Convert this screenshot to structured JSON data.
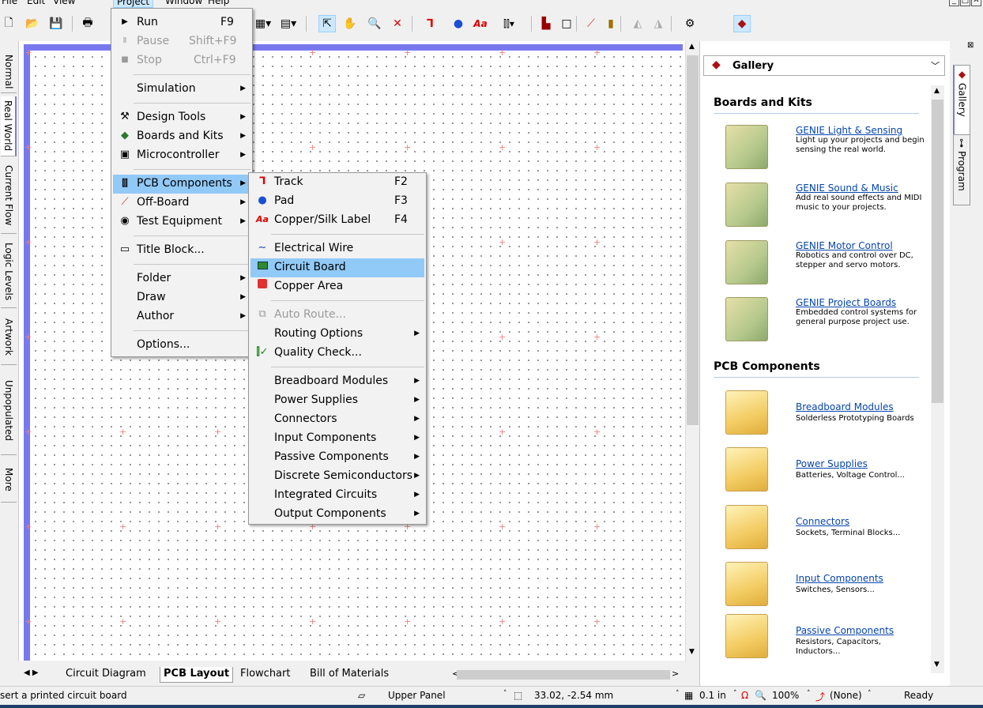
{
  "menubar": {
    "items": [
      "File",
      "Edit",
      "View",
      "Project",
      "Window",
      "Help"
    ],
    "active": "Project"
  },
  "project_menu": {
    "run": {
      "label": "Run",
      "shortcut": "F9"
    },
    "pause": {
      "label": "Pause",
      "shortcut": "Shift+F9"
    },
    "stop": {
      "label": "Stop",
      "shortcut": "Ctrl+F9"
    },
    "simulation": "Simulation",
    "design_tools": "Design Tools",
    "boards_and_kits": "Boards and Kits",
    "microcontroller": "Microcontroller",
    "pcb_components": "PCB Components",
    "off_board": "Off-Board",
    "test_equipment": "Test Equipment",
    "title_block": "Title Block...",
    "folder": "Folder",
    "draw": "Draw",
    "author": "Author",
    "options": "Options..."
  },
  "pcb_submenu": {
    "track": {
      "label": "Track",
      "shortcut": "F2"
    },
    "pad": {
      "label": "Pad",
      "shortcut": "F3"
    },
    "copper_silk_label": {
      "label": "Copper/Silk Label",
      "shortcut": "F4"
    },
    "electrical_wire": "Electrical Wire",
    "circuit_board": "Circuit Board",
    "copper_area": "Copper Area",
    "auto_route": "Auto Route...",
    "routing_options": "Routing Options",
    "quality_check": "Quality Check...",
    "breadboard_modules": "Breadboard Modules",
    "power_supplies": "Power Supplies",
    "connectors": "Connectors",
    "input_components": "Input Components",
    "passive_components": "Passive Components",
    "discrete_semiconductors": "Discrete Semiconductors",
    "integrated_circuits": "Integrated Circuits",
    "output_components": "Output Components"
  },
  "left_tabs": [
    "Normal",
    "Real World",
    "Current Flow",
    "Logic Levels",
    "Artwork",
    "Unpopulated",
    "More"
  ],
  "bottom_tabs": [
    "Circuit Diagram",
    "PCB Layout",
    "Flowchart",
    "Bill of Materials"
  ],
  "gallery": {
    "title": "Gallery",
    "sections": [
      {
        "title": "Boards and Kits",
        "items": [
          {
            "link": "GENIE Light & Sensing",
            "desc": "Light up your projects and begin sensing the real world."
          },
          {
            "link": "GENIE Sound & Music",
            "desc": "Add real sound effects and MIDI music to your projects."
          },
          {
            "link": "GENIE Motor Control",
            "desc": "Robotics and control over DC, stepper and servo motors."
          },
          {
            "link": "GENIE Project Boards",
            "desc": "Embedded control systems for general purpose project use."
          }
        ]
      },
      {
        "title": "PCB Components",
        "items": [
          {
            "link": "Breadboard Modules",
            "desc": "Solderless Prototyping Boards"
          },
          {
            "link": "Power Supplies",
            "desc": "Batteries, Voltage Control..."
          },
          {
            "link": "Connectors",
            "desc": "Sockets, Terminal Blocks..."
          },
          {
            "link": "Input Components",
            "desc": "Switches, Sensors..."
          },
          {
            "link": "Passive Components",
            "desc": "Resistors, Capacitors, Inductors..."
          }
        ]
      }
    ]
  },
  "right_tabs": [
    "Gallery",
    "Program"
  ],
  "status": {
    "hint": "sert a printed circuit board",
    "panel": "Upper Panel",
    "coords": "33.02, -2.54 mm",
    "grid": "0.1 in",
    "zoom": "100%",
    "probe": "(None)",
    "state": "Ready"
  },
  "icons": {
    "toolbar": [
      "new-icon",
      "open-icon",
      "save-icon",
      "print-icon",
      "select-icon",
      "hand-icon",
      "zoom-icon",
      "delete-icon",
      "track-icon",
      "pad-icon",
      "label-icon"
    ]
  }
}
